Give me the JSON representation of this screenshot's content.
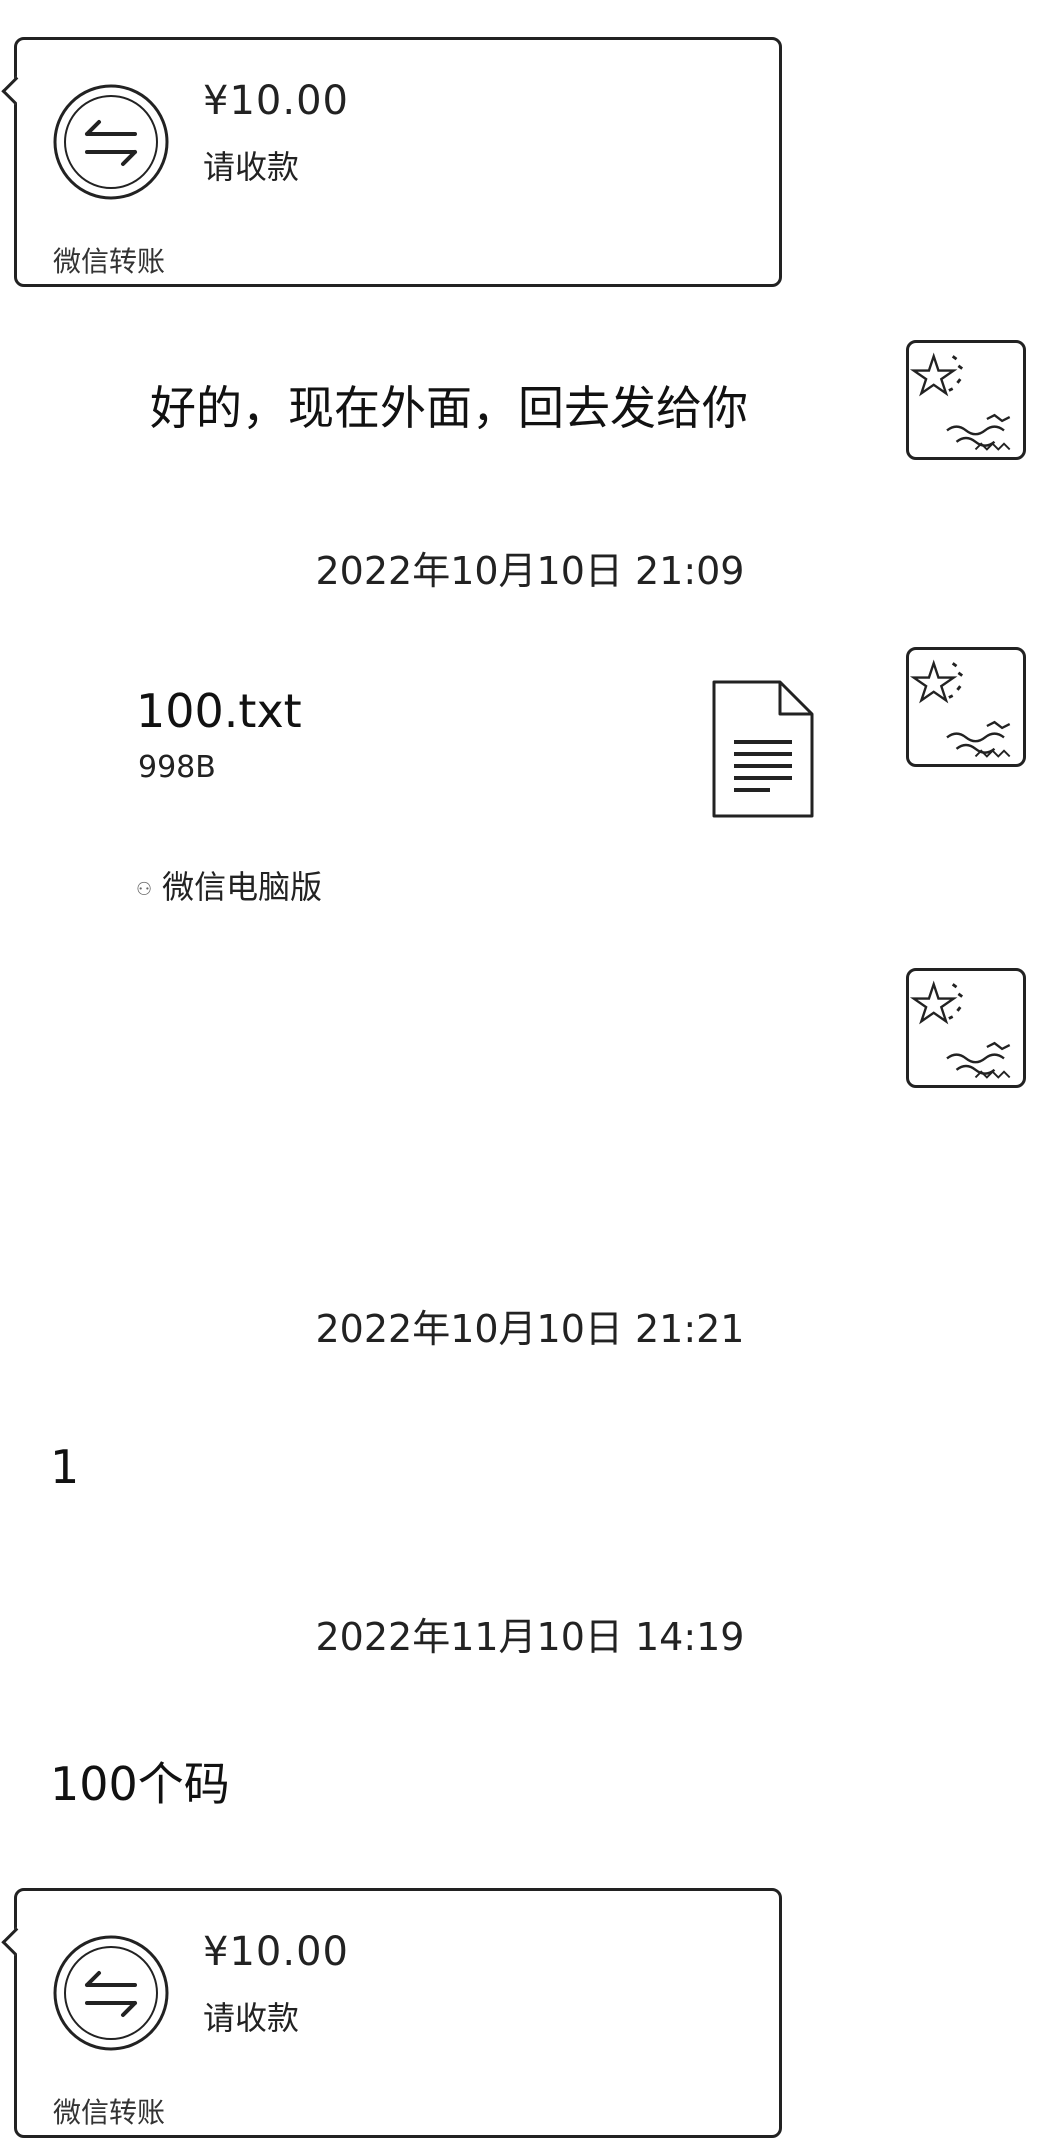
{
  "transfers": [
    {
      "amount": "¥10.00",
      "status": "请收款",
      "source": "微信转账",
      "icon": "transfer-arrows-icon"
    },
    {
      "amount": "¥10.00",
      "status": "请收款",
      "source": "微信转账",
      "icon": "transfer-arrows-icon"
    }
  ],
  "messages": {
    "reply_text": "好的，现在外面，回去发给你",
    "text_1": "1",
    "text_2": "100个码"
  },
  "timestamps": [
    "2022年10月10日 21:09",
    "2022年10月10日 21:21",
    "2022年11月10日 14:19"
  ],
  "file": {
    "name": "100.txt",
    "size": "998B",
    "source": "微信电脑版",
    "icon": "document-icon",
    "source_icon": "wechat-icon"
  },
  "avatar": {
    "icon": "flag-avatar-icon"
  }
}
